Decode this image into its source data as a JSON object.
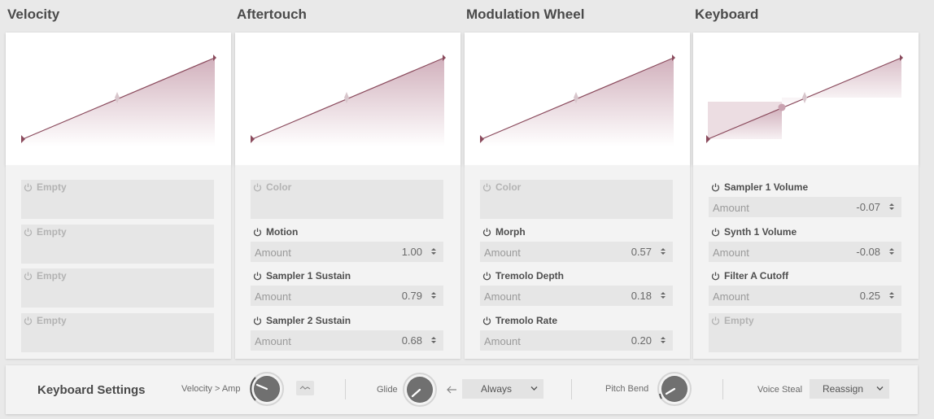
{
  "columns": [
    {
      "title": "Velocity",
      "slots": [
        {
          "label": "Empty",
          "empty": true
        },
        {
          "label": "Empty",
          "empty": true
        },
        {
          "label": "Empty",
          "empty": true
        },
        {
          "label": "Empty",
          "empty": true
        }
      ]
    },
    {
      "title": "Aftertouch",
      "slots": [
        {
          "label": "Color",
          "empty": true
        },
        {
          "label": "Motion",
          "empty": false,
          "amount_label": "Amount",
          "amount": "1.00"
        },
        {
          "label": "Sampler 1 Sustain",
          "empty": false,
          "amount_label": "Amount",
          "amount": "0.79"
        },
        {
          "label": "Sampler 2 Sustain",
          "empty": false,
          "amount_label": "Amount",
          "amount": "0.68"
        }
      ]
    },
    {
      "title": "Modulation Wheel",
      "slots": [
        {
          "label": "Color",
          "empty": true
        },
        {
          "label": "Morph",
          "empty": false,
          "amount_label": "Amount",
          "amount": "0.57"
        },
        {
          "label": "Tremolo Depth",
          "empty": false,
          "amount_label": "Amount",
          "amount": "0.18"
        },
        {
          "label": "Tremolo Rate",
          "empty": false,
          "amount_label": "Amount",
          "amount": "0.20"
        }
      ]
    },
    {
      "title": "Keyboard",
      "slots": [
        {
          "label": "Sampler 1 Volume",
          "empty": false,
          "amount_label": "Amount",
          "amount": "-0.07"
        },
        {
          "label": "Synth 1 Volume",
          "empty": false,
          "amount_label": "Amount",
          "amount": "-0.08"
        },
        {
          "label": "Filter A Cutoff",
          "empty": false,
          "amount_label": "Amount",
          "amount": "0.25"
        },
        {
          "label": "Empty",
          "empty": true
        }
      ]
    }
  ],
  "bottom": {
    "title": "Keyboard Settings",
    "velocity_amp_label": "Velocity > Amp",
    "glide_label": "Glide",
    "glide_mode": "Always",
    "pitch_bend_label": "Pitch Bend",
    "voice_steal_label": "Voice Steal",
    "voice_steal_mode": "Reassign"
  },
  "colors": {
    "curve_line": "#8a4a5c",
    "curve_fill": "#c9a2b0",
    "panel": "#f3f3f3",
    "slot": "#e6e6e6"
  }
}
